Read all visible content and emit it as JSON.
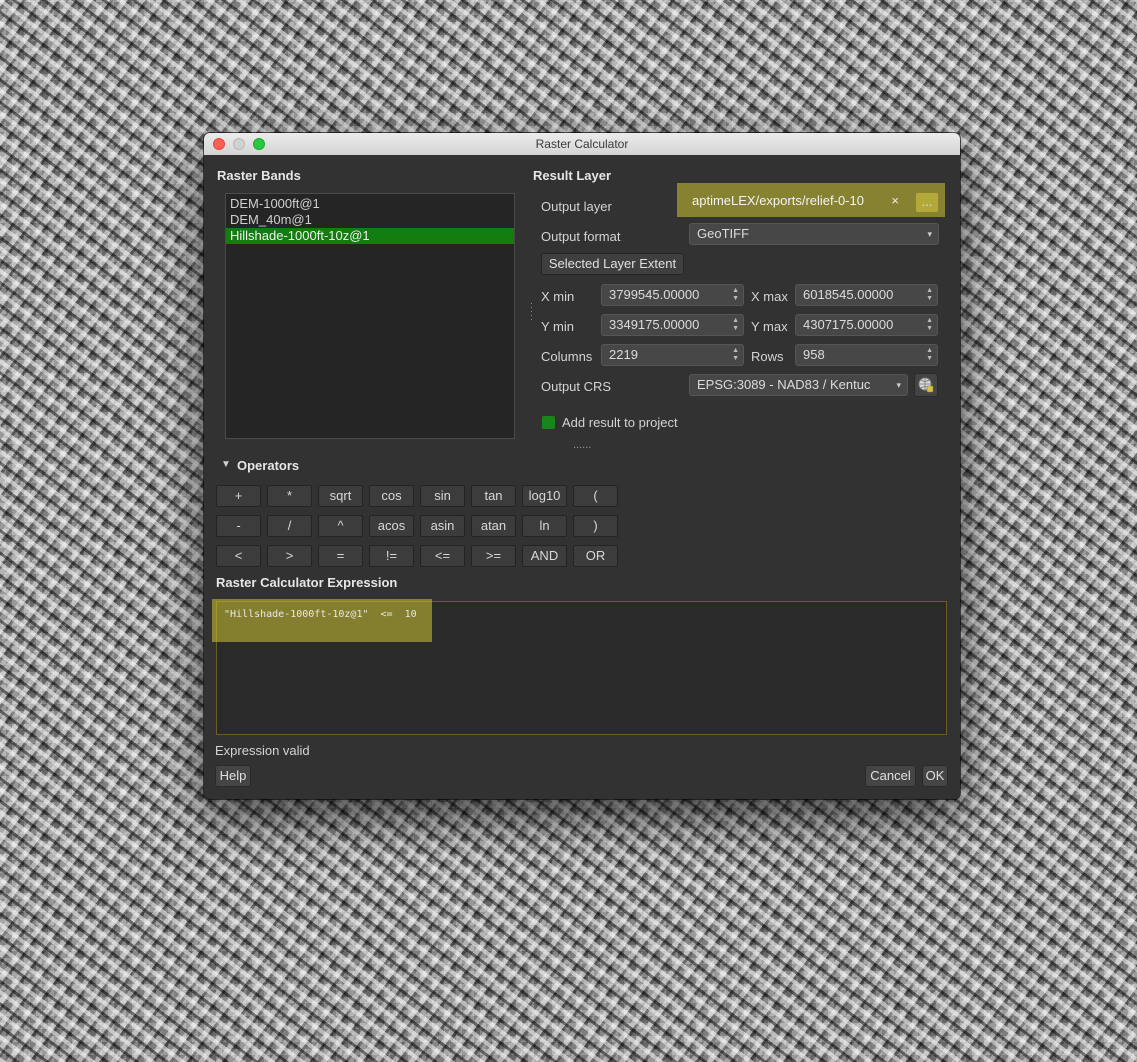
{
  "window": {
    "title": "Raster Calculator"
  },
  "raster_bands": {
    "heading": "Raster Bands",
    "items": [
      "DEM-1000ft@1",
      "DEM_40m@1",
      "Hillshade-1000ft-10z@1"
    ],
    "selected": "Hillshade-1000ft-10z@1"
  },
  "result_layer": {
    "heading": "Result Layer",
    "output_layer_label": "Output layer",
    "output_layer_value": "aptimeLEX/exports/relief-0-10",
    "clear_glyph": "×",
    "browse_label": "...",
    "output_format_label": "Output format",
    "output_format_value": "GeoTIFF",
    "extent_button": "Selected Layer Extent",
    "xmin_label": "X min",
    "xmin_value": "3799545.00000",
    "xmax_label": "X max",
    "xmax_value": "6018545.00000",
    "ymin_label": "Y min",
    "ymin_value": "3349175.00000",
    "ymax_label": "Y max",
    "ymax_value": "4307175.00000",
    "columns_label": "Columns",
    "columns_value": "2219",
    "rows_label": "Rows",
    "rows_value": "958",
    "crs_label": "Output CRS",
    "crs_value": "EPSG:3089 - NAD83 / Kentuc",
    "add_result_label": "Add result to project",
    "add_result_checked": true,
    "dots": "......"
  },
  "operators": {
    "heading": "Operators",
    "row1": [
      "+",
      "*",
      "sqrt",
      "cos",
      "sin",
      "tan",
      "log10",
      "("
    ],
    "row2": [
      "-",
      "/",
      "^",
      "acos",
      "asin",
      "atan",
      "ln",
      ")"
    ],
    "row3": [
      "<",
      ">",
      "=",
      "!=",
      "<=",
      ">=",
      "AND",
      "OR"
    ]
  },
  "expression": {
    "heading": "Raster Calculator Expression",
    "text": "\"Hillshade-1000ft-10z@1\"  <=  10",
    "status": "Expression valid"
  },
  "buttons": {
    "help": "Help",
    "cancel": "Cancel",
    "ok": "OK"
  },
  "colors": {
    "highlight": "#cec432",
    "selection": "#137d10",
    "checkbox": "#18861a"
  }
}
